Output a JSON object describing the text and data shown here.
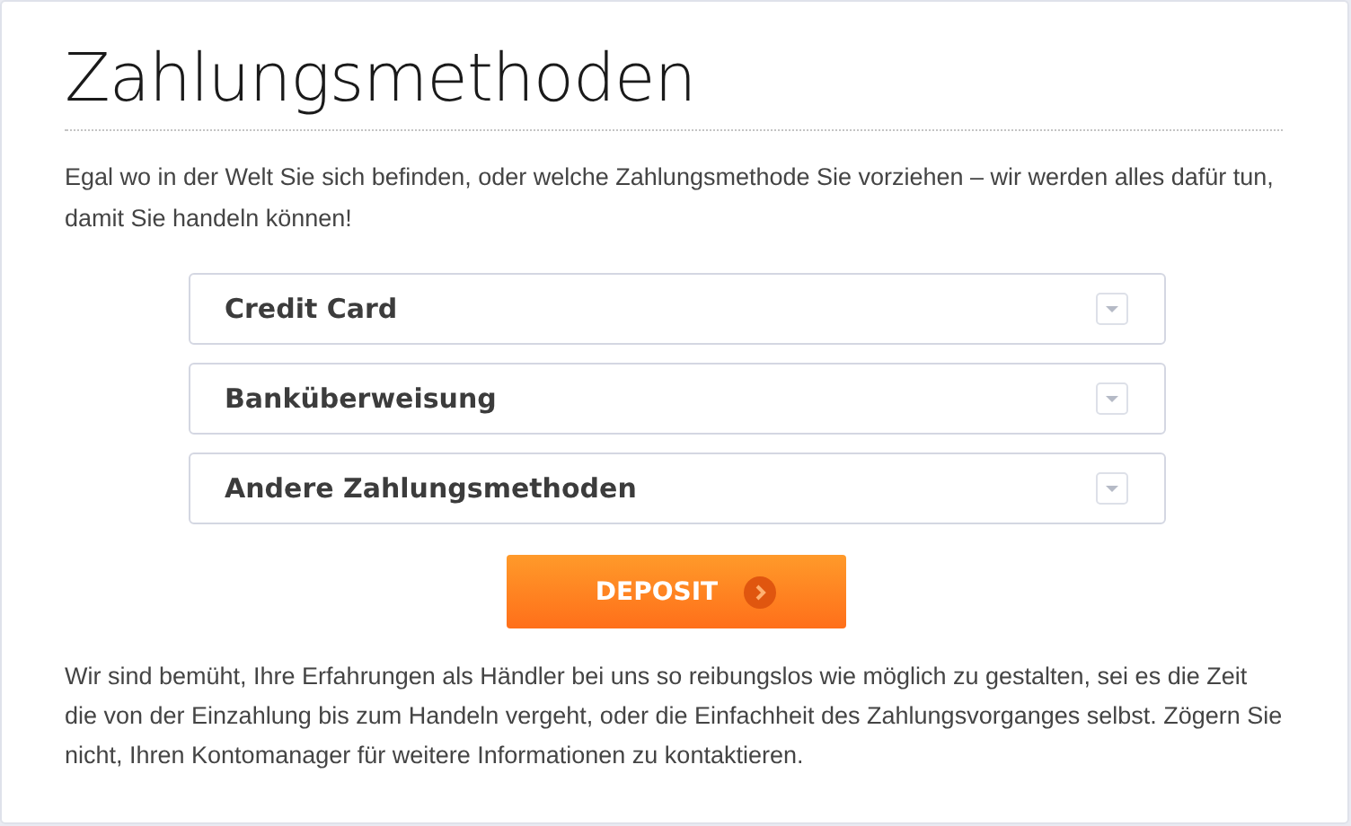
{
  "title": "Zahlungsmethoden",
  "intro": "Egal wo in der Welt Sie sich befinden, oder welche Zahlungsmethode Sie vorziehen – wir werden alles dafür tun, damit Sie handeln können!",
  "methods": [
    {
      "label": "Credit Card",
      "expanded": false
    },
    {
      "label": "Banküberweisung",
      "expanded": false
    },
    {
      "label": "Andere Zahlungsmethoden",
      "expanded": false
    }
  ],
  "button": {
    "label": "DEPOSIT"
  },
  "footer": "Wir sind bemüht, Ihre Erfahrungen als Händler bei uns so reibungslos wie möglich zu gestalten, sei es die Zeit die von der Einzahlung bis zum Handeln vergeht, oder die Einfachheit des Zahlungsvorganges selbst. Zögern Sie nicht, Ihren Kontomanager für weitere Informationen zu kontaktieren."
}
